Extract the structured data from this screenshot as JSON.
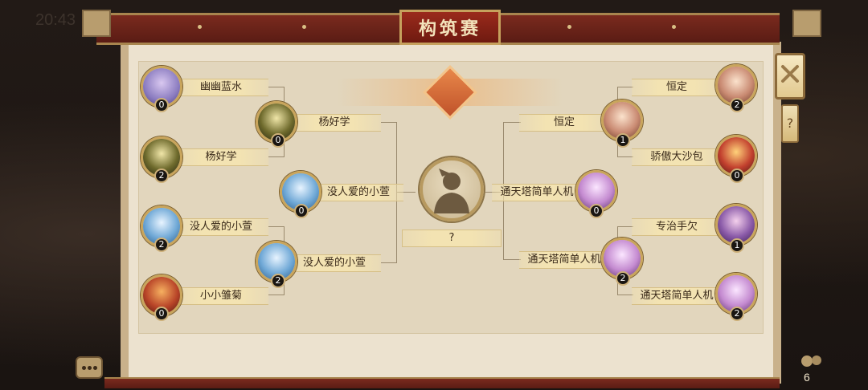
{
  "status_bar": {
    "time": "20:43"
  },
  "title": "构筑赛",
  "center": {
    "winner_placeholder": "?"
  },
  "viewers": {
    "count": "6"
  },
  "left": {
    "round1": [
      {
        "name": "幽幽蓝水",
        "score": "0",
        "art": "#8b7cc0"
      },
      {
        "name": "杨好学",
        "score": "2",
        "art": "#6e6a2c"
      },
      {
        "name": "没人爱的小萱",
        "score": "2",
        "art": "#6fa8d6"
      },
      {
        "name": "小小雏菊",
        "score": "0",
        "art": "#b84428"
      }
    ],
    "round2": [
      {
        "name": "杨好学",
        "score": "0",
        "art": "#6e6a2c"
      },
      {
        "name": "没人爱的小萱",
        "score": "2",
        "art": "#6fa8d6"
      }
    ],
    "final": {
      "name": "没人爱的小萱",
      "score": "0",
      "art": "#6fa8d6"
    }
  },
  "right": {
    "round1": [
      {
        "name": "恒定",
        "score": "2",
        "art": "#c98a72"
      },
      {
        "name": "骄傲大沙包",
        "score": "0",
        "art": "#c2402e"
      },
      {
        "name": "专治手欠",
        "score": "1",
        "art": "#8a5aa8"
      },
      {
        "name": "通天塔简单人机",
        "score": "2",
        "art": "#c48ad0"
      }
    ],
    "round2": [
      {
        "name": "恒定",
        "score": "1",
        "art": "#c98a72"
      },
      {
        "name": "通天塔简单人机",
        "score": "2",
        "art": "#c48ad0"
      }
    ],
    "final": {
      "name": "通天塔简单人机",
      "score": "0",
      "art": "#c48ad0"
    }
  }
}
